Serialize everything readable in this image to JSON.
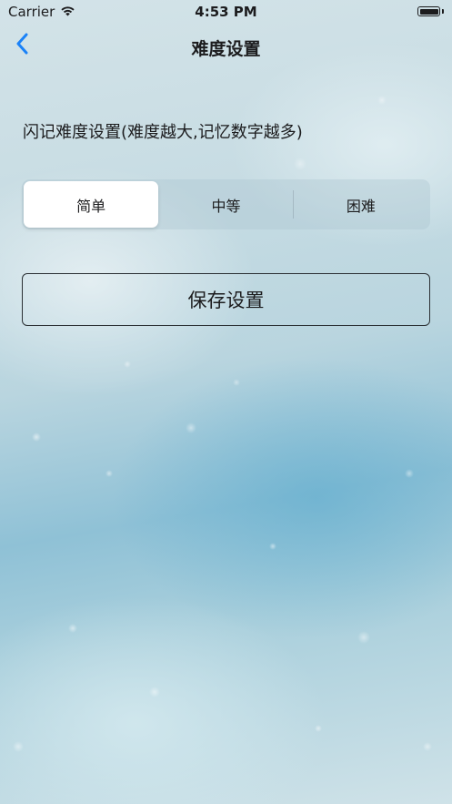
{
  "status_bar": {
    "carrier": "Carrier",
    "time": "4:53 PM",
    "battery_level": 1.0
  },
  "nav": {
    "title": "难度设置",
    "back_icon": "chevron-left-icon"
  },
  "section": {
    "label": "闪记难度设置(难度越大,记忆数字越多)"
  },
  "difficulty": {
    "options": [
      "简单",
      "中等",
      "困难"
    ],
    "selected": "简单"
  },
  "save": {
    "label": "保存设置"
  },
  "colors": {
    "accent": "#1a82f7",
    "text": "#1c1c1e",
    "button_border": "#2a2f33"
  }
}
